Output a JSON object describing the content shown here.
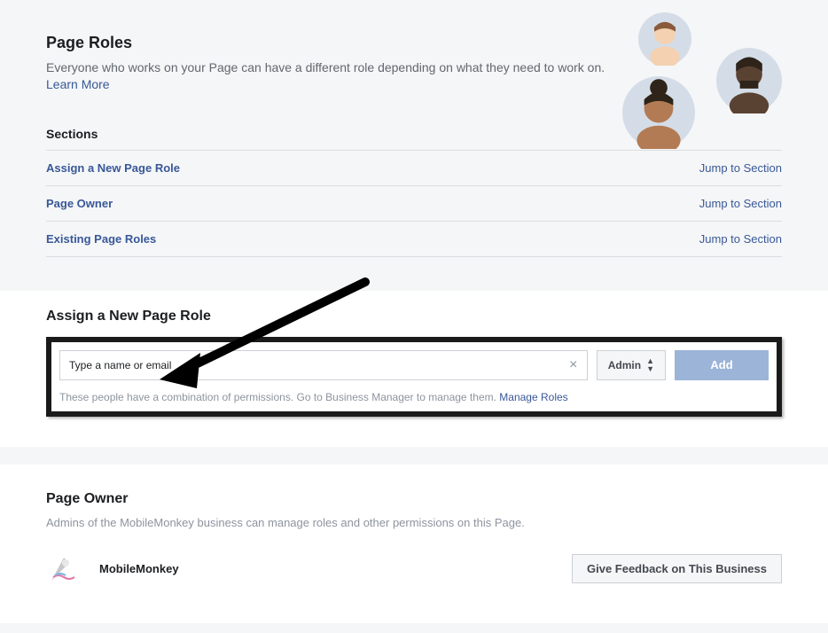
{
  "header": {
    "title": "Page Roles",
    "description": "Everyone who works on your Page can have a different role depending on what they need to work on.",
    "learn_more": "Learn More"
  },
  "sections": {
    "heading": "Sections",
    "items": [
      {
        "label": "Assign a New Page Role",
        "jump": "Jump to Section"
      },
      {
        "label": "Page Owner",
        "jump": "Jump to Section"
      },
      {
        "label": "Existing Page Roles",
        "jump": "Jump to Section"
      }
    ]
  },
  "assign": {
    "title": "Assign a New Page Role",
    "input_value": "Type a name or email",
    "role": "Admin",
    "add_label": "Add",
    "note_prefix": "These people have a combination of permissions. Go to Business Manager to manage them. ",
    "manage_roles": "Manage Roles"
  },
  "owner": {
    "title": "Page Owner",
    "description": "Admins of the MobileMonkey business can manage roles and other permissions on this Page.",
    "name": "MobileMonkey",
    "feedback_button": "Give Feedback on This Business"
  }
}
